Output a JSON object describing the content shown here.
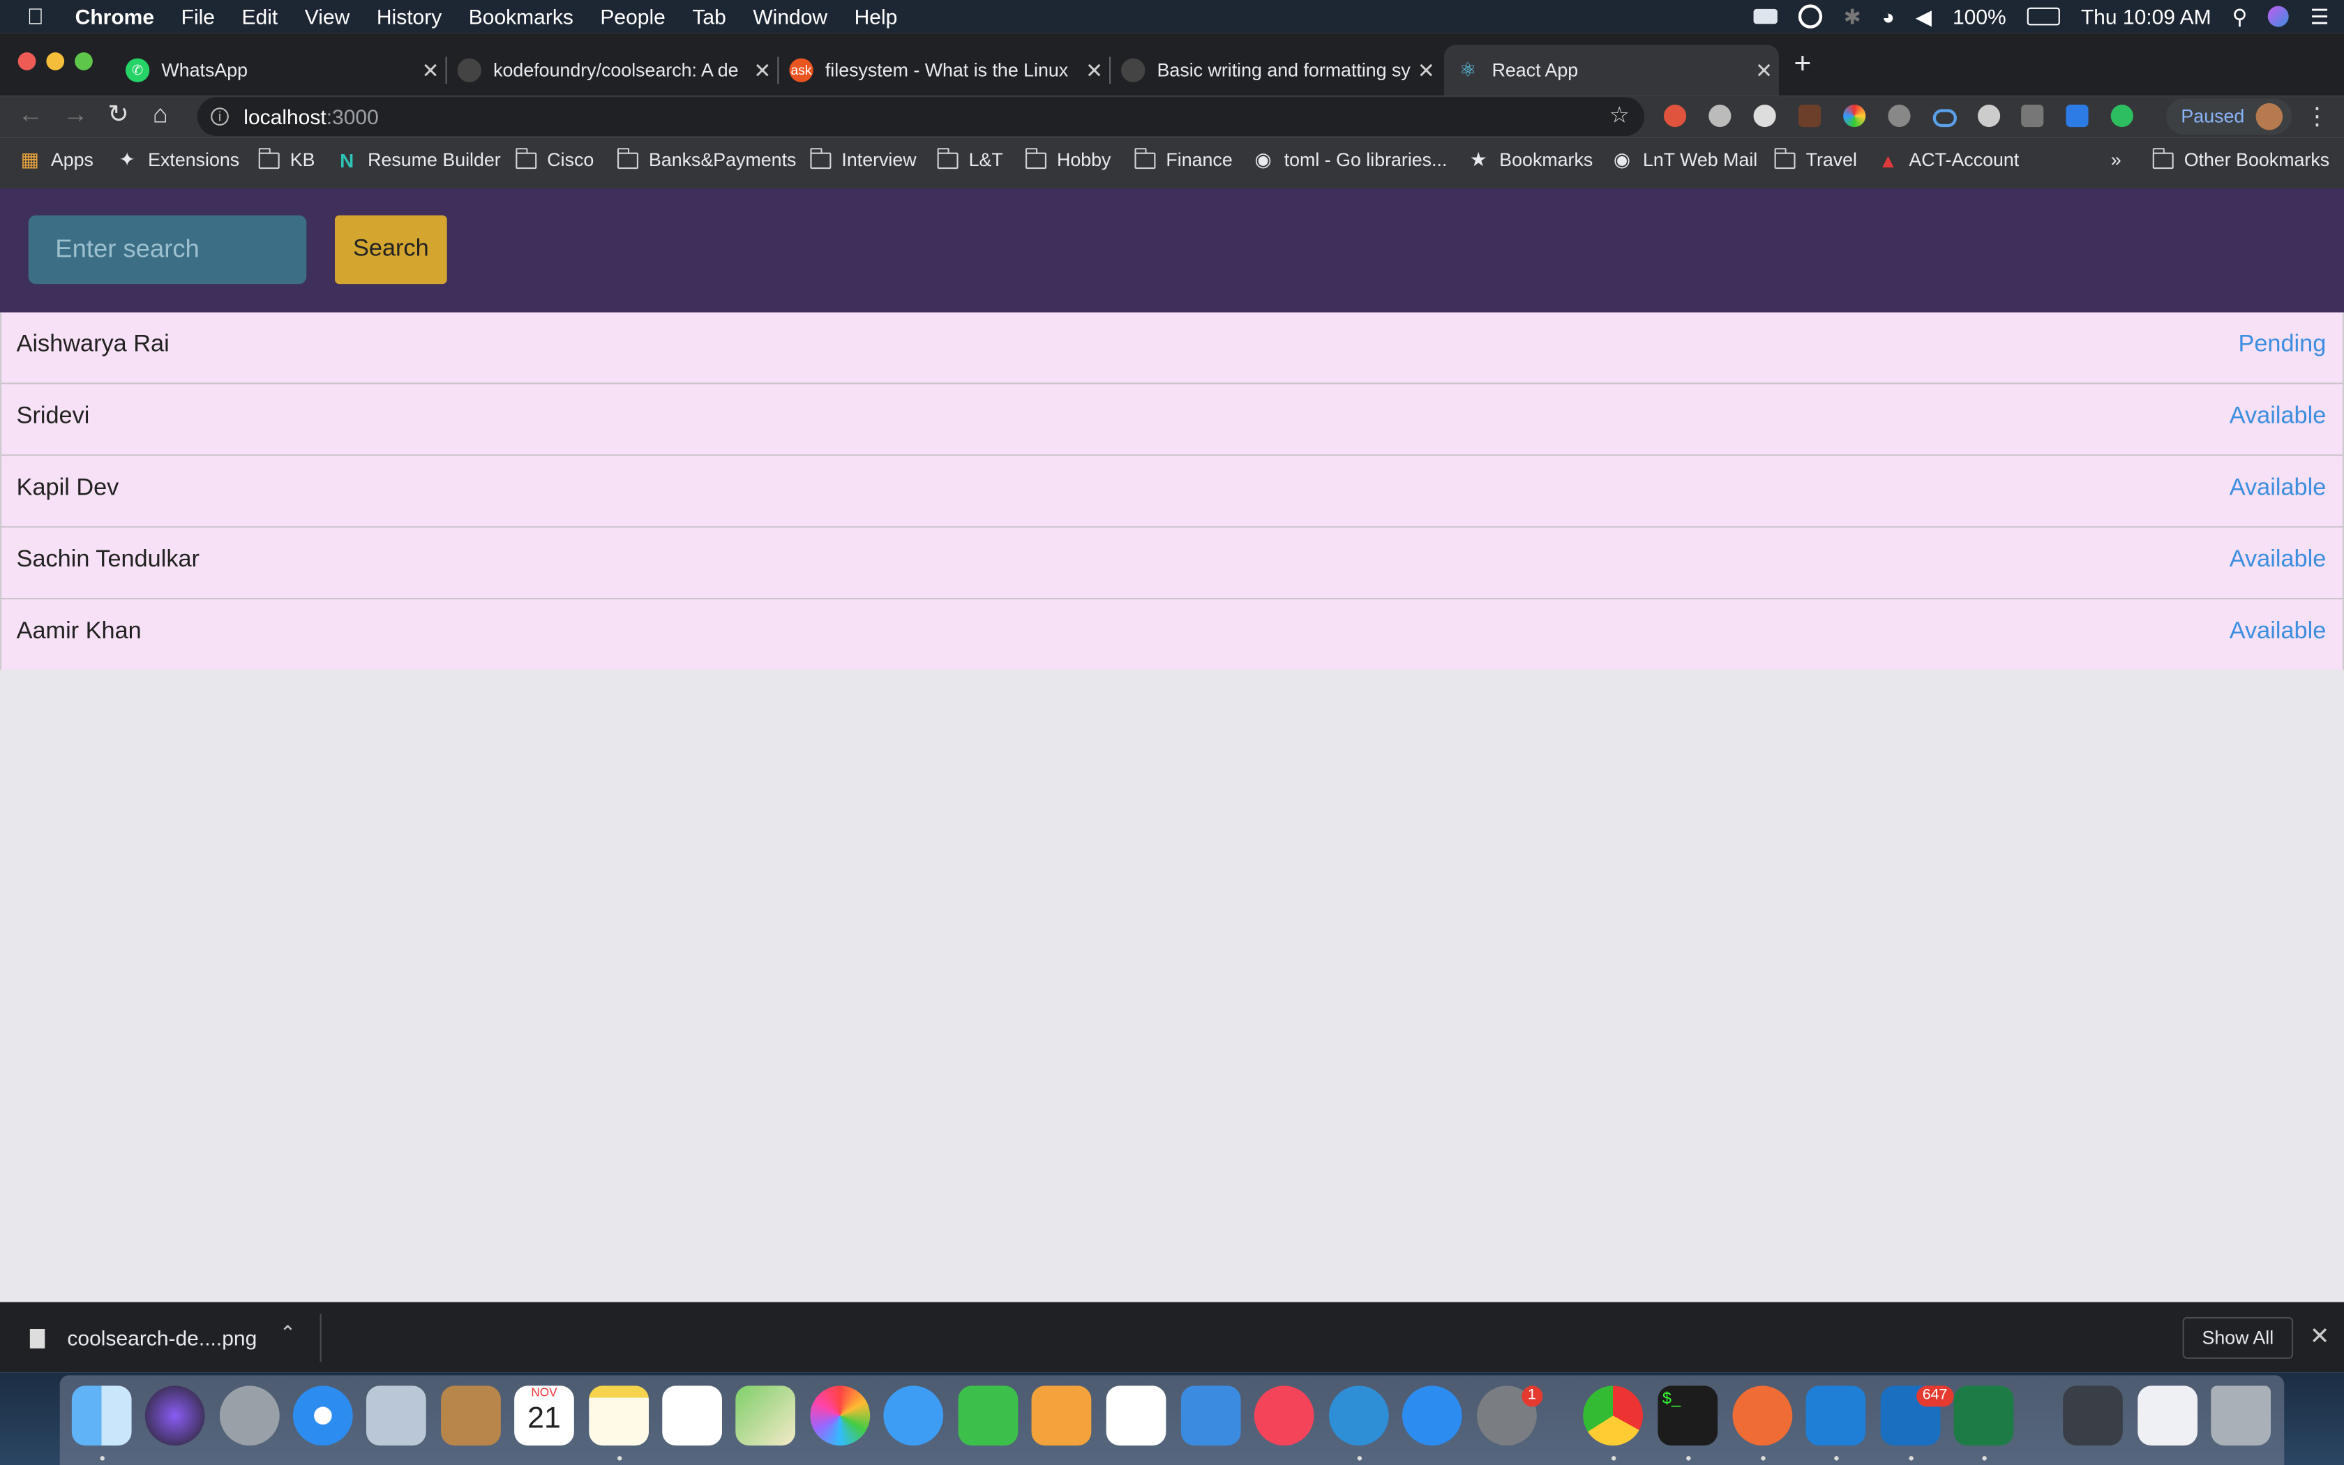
{
  "menubar": {
    "app": "Chrome",
    "items": [
      "File",
      "Edit",
      "View",
      "History",
      "Bookmarks",
      "People",
      "Tab",
      "Window",
      "Help"
    ],
    "battery": "100%",
    "clock": "Thu 10:09 AM"
  },
  "tabs": [
    {
      "title": "WhatsApp",
      "icon": "whatsapp-icon",
      "color": "#25d366"
    },
    {
      "title": "kodefoundry/coolsearch: A de",
      "icon": "github-icon",
      "color": "#444444"
    },
    {
      "title": "filesystem - What is the Linux",
      "icon": "askubuntu-icon",
      "color": "#e95420"
    },
    {
      "title": "Basic writing and formatting sy",
      "icon": "github-icon",
      "color": "#444444"
    },
    {
      "title": "React App",
      "icon": "react-icon",
      "color": "#61dafb"
    }
  ],
  "toolbar": {
    "url_host": "localhost",
    "url_port": ":3000",
    "profile_label": "Paused"
  },
  "bookmarks": [
    {
      "label": "Apps",
      "icon": "apps-grid-icon"
    },
    {
      "label": "Extensions",
      "icon": "puzzle-icon"
    },
    {
      "label": "KB",
      "icon": "folder-icon"
    },
    {
      "label": "Resume Builder",
      "icon": "n-logo-icon"
    },
    {
      "label": "Cisco",
      "icon": "folder-icon"
    },
    {
      "label": "Banks&Payments",
      "icon": "folder-icon"
    },
    {
      "label": "Interview",
      "icon": "folder-icon"
    },
    {
      "label": "L&T",
      "icon": "folder-icon"
    },
    {
      "label": "Hobby",
      "icon": "folder-icon"
    },
    {
      "label": "Finance",
      "icon": "folder-icon"
    },
    {
      "label": "toml - Go libraries...",
      "icon": "globe-icon"
    },
    {
      "label": "Bookmarks",
      "icon": "star-icon"
    },
    {
      "label": "LnT Web Mail",
      "icon": "globe-icon"
    },
    {
      "label": "Travel",
      "icon": "folder-icon"
    },
    {
      "label": "ACT-Account",
      "icon": "act-logo-icon"
    }
  ],
  "bookmarks_overflow": "»",
  "other_bookmarks": "Other Bookmarks",
  "app": {
    "search_placeholder": "Enter search",
    "search_button": "Search",
    "people": [
      {
        "name": "Aishwarya Rai",
        "status": "Pending"
      },
      {
        "name": "Sridevi",
        "status": "Available"
      },
      {
        "name": "Kapil Dev",
        "status": "Available"
      },
      {
        "name": "Sachin Tendulkar",
        "status": "Available"
      },
      {
        "name": "Aamir Khan",
        "status": "Available"
      }
    ]
  },
  "download_shelf": {
    "file_name": "coolsearch-de....png",
    "show_all": "Show All"
  },
  "dock": {
    "calendar_month": "NOV",
    "calendar_day": "21",
    "system_prefs_badge": "1",
    "outlook_badge": "647"
  },
  "colors": {
    "header_bg": "#3e2f5b",
    "search_input_bg": "#3c6e86",
    "search_button_bg": "#d4a62f",
    "row_bg": "#f7e1f6",
    "status_color": "#3d8ee0"
  }
}
